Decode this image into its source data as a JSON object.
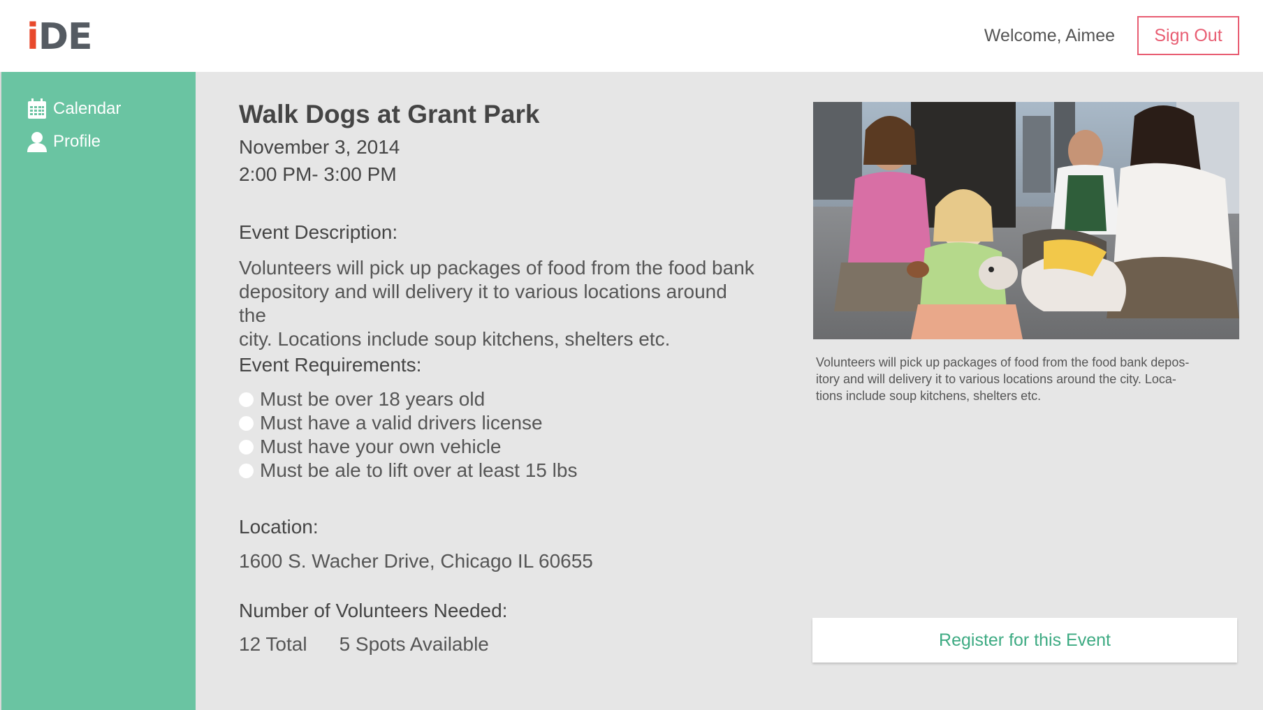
{
  "header": {
    "logo_i": "i",
    "logo_de": "DE",
    "welcome": "Welcome, Aimee",
    "sign_out": "Sign Out"
  },
  "sidebar": {
    "items": [
      {
        "label": "Calendar",
        "icon": "calendar-icon"
      },
      {
        "label": "Profile",
        "icon": "person-icon"
      }
    ],
    "color": "#6ac4a2"
  },
  "event": {
    "title": "Walk Dogs at Grant Park",
    "date": "November 3, 2014",
    "time": "2:00 PM- 3:00 PM",
    "description_heading": "Event Description:",
    "description_line1": "Volunteers will pick up packages of food from the food bank",
    "description_line2": "depository and will delivery it to various locations around the",
    "description_line3": "city. Locations include soup kitchens, shelters etc.",
    "requirements_heading": "Event Requirements:",
    "requirements": [
      "Must be over 18 years old",
      "Must have a valid drivers license",
      "Must have your own vehicle",
      "Must be ale to lift over at least 15 lbs"
    ],
    "location_heading": "Location:",
    "location": "1600 S. Wacher Drive, Chicago IL 60655",
    "volunteers_heading": "Number of Volunteers Needed:",
    "total": "12 Total",
    "available": "5 Spots Available"
  },
  "photo": {
    "caption_line1": "Volunteers will pick up packages of food from the food bank depos-",
    "caption_line2": "itory and will delivery it to various locations around the city. Loca-",
    "caption_line3": "tions include soup kitchens, shelters etc."
  },
  "register_label": "Register for this Event",
  "colors": {
    "accent_green": "#3daa82",
    "sign_out_red": "#e85d72",
    "logo_red": "#e8492c"
  }
}
